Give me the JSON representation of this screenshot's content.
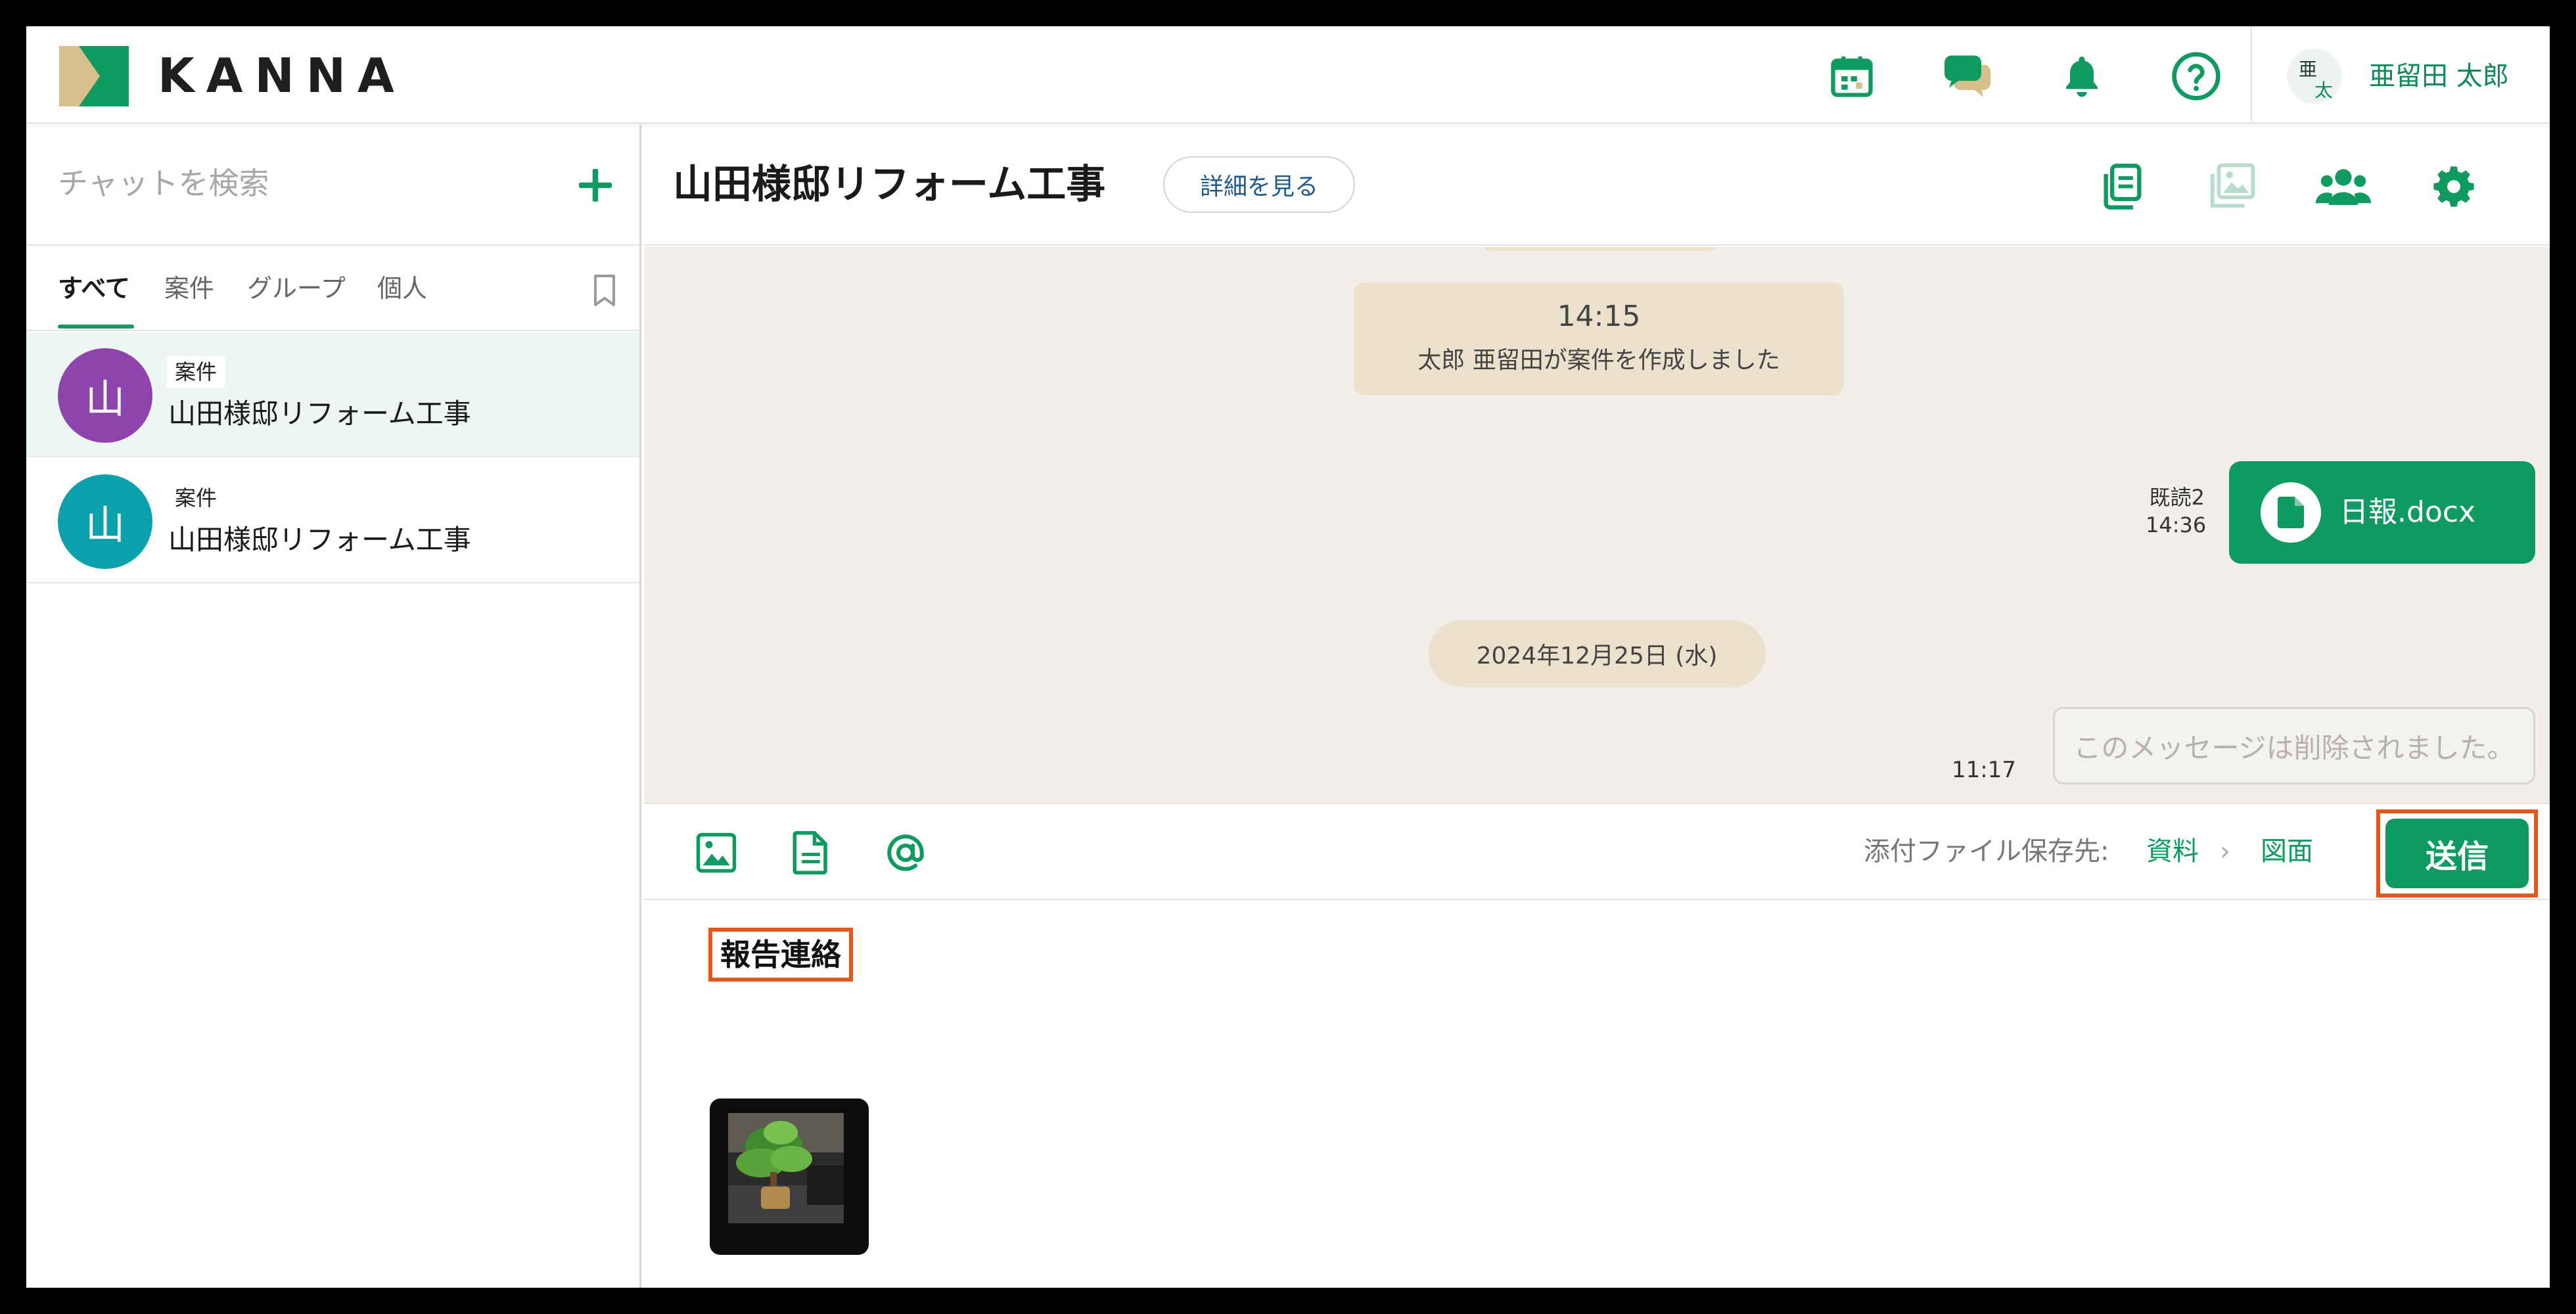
{
  "app": {
    "logo_text": "KANNA",
    "brand_color": "#0f9a61"
  },
  "header": {
    "icons": [
      "calendar-icon",
      "chat-bubbles-icon",
      "bell-icon",
      "help-icon"
    ],
    "user": {
      "avatar_top": "亜",
      "avatar_bottom": "太",
      "name": "亜留田 太郎"
    }
  },
  "sidebar": {
    "search_placeholder": "チャットを検索",
    "tabs": [
      "すべて",
      "案件",
      "グループ",
      "個人"
    ],
    "active_tab": "すべて",
    "rooms": [
      {
        "avatar_char": "山",
        "avatar_color": "#8e44ad",
        "tag": "案件",
        "title": "山田様邸リフォーム工事",
        "selected": true
      },
      {
        "avatar_char": "山",
        "avatar_color": "#0aa1ad",
        "tag": "案件",
        "title": "山田様邸リフォーム工事",
        "selected": false
      }
    ]
  },
  "chat": {
    "title": "山田様邸リフォーム工事",
    "detail_button": "詳細を見る",
    "header_icons": [
      "files-icon",
      "images-icon",
      "members-icon",
      "settings-icon"
    ],
    "messages": {
      "system": {
        "time": "14:15",
        "text": "太郎 亜留田が案件を作成しました"
      },
      "file": {
        "read_label": "既読2",
        "time": "14:36",
        "file_name": "日報.docx"
      },
      "date_separator": "2024年12月25日 (水)",
      "deleted": {
        "time": "11:17",
        "text": "このメッセージは削除されました。"
      }
    },
    "toolbar": {
      "icons": [
        "image-icon",
        "file-icon",
        "mention-icon"
      ],
      "save_label": "添付ファイル保存先:",
      "crumbs": [
        "資料",
        "図面"
      ],
      "send_label": "送信"
    },
    "compose": {
      "text": "報告連絡",
      "attachment": "photo-thumbnail"
    }
  }
}
